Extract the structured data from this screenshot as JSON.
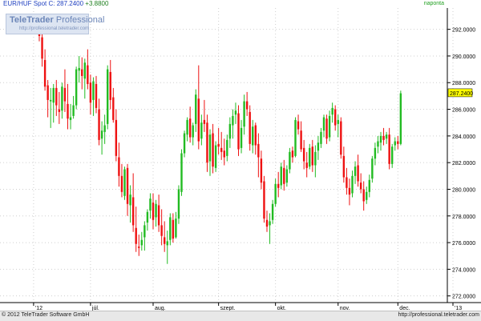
{
  "header": {
    "title": "EUR/HUF Spot  C: 287.2400  +3.8800",
    "instrument": "EUR/HUF Spot",
    "close_label": "C: 287.2400",
    "change_label": "+3.8800",
    "period": "naponta"
  },
  "logo": {
    "name_bold": "TeleTrader",
    "name_light": " Professional",
    "url": "http://professional.teletrader.com"
  },
  "footer": {
    "copyright": "© 2012 TeleTrader Software GmbH",
    "url": "http://professional.teletrader.com"
  },
  "colors": {
    "up": "#22bb22",
    "down": "#ee1111",
    "grid": "#cfcfcf",
    "axis": "#000000",
    "price_tag": "#ffff00"
  },
  "chart_data": {
    "type": "candlestick",
    "title": "EUR/HUF Spot",
    "ylim": [
      271.5,
      293.6
    ],
    "y_ticks": [
      "272.0000",
      "274.0000",
      "276.0000",
      "278.0000",
      "280.0000",
      "282.0000",
      "284.0000",
      "286.0000",
      "288.0000",
      "290.0000",
      "292.0000"
    ],
    "x_ticks": [
      {
        "label": "'12",
        "index": -2
      },
      {
        "label": "júl.",
        "index": 18
      },
      {
        "label": "aug.",
        "index": 40
      },
      {
        "label": "szept.",
        "index": 63
      },
      {
        "label": "okt.",
        "index": 83
      },
      {
        "label": "nov.",
        "index": 105
      },
      {
        "label": "dec.",
        "index": 126
      },
      {
        "label": "'13",
        "index": 147
      }
    ],
    "last_price_label": "287.2400",
    "last_price": 287.24,
    "grid": true,
    "candles": [
      [
        292.9,
        293.1,
        291.1,
        291.5
      ],
      [
        291.4,
        291.8,
        289.2,
        289.8
      ],
      [
        289.7,
        290.5,
        287.4,
        287.7
      ],
      [
        287.8,
        288.2,
        285.4,
        286.7
      ],
      [
        286.6,
        287.6,
        284.6,
        286.7
      ],
      [
        286.5,
        287.9,
        285.0,
        287.6
      ],
      [
        287.6,
        288.2,
        285.5,
        286.3
      ],
      [
        286.0,
        287.3,
        284.9,
        285.8
      ],
      [
        285.9,
        288.0,
        285.3,
        287.7
      ],
      [
        287.6,
        289.0,
        285.8,
        286.6
      ],
      [
        286.4,
        287.9,
        284.5,
        285.3
      ],
      [
        285.2,
        286.4,
        284.5,
        285.4
      ],
      [
        285.5,
        287.0,
        285.3,
        286.3
      ],
      [
        286.3,
        289.2,
        286.0,
        289.0
      ],
      [
        288.9,
        290.0,
        288.0,
        289.1
      ],
      [
        289.0,
        289.9,
        287.5,
        288.5
      ],
      [
        288.3,
        289.8,
        286.8,
        289.5
      ],
      [
        289.3,
        290.5,
        287.5,
        287.9
      ],
      [
        288.0,
        288.6,
        285.6,
        286.5
      ],
      [
        286.7,
        288.4,
        285.5,
        288.1
      ],
      [
        287.9,
        288.5,
        285.7,
        286.1
      ],
      [
        286.0,
        286.8,
        283.3,
        283.7
      ],
      [
        283.8,
        285.1,
        282.6,
        284.4
      ],
      [
        284.3,
        285.6,
        283.4,
        284.8
      ],
      [
        284.9,
        289.3,
        284.5,
        289.0
      ],
      [
        288.8,
        289.7,
        286.0,
        286.7
      ],
      [
        286.9,
        287.6,
        285.0,
        285.2
      ],
      [
        285.2,
        286.0,
        282.1,
        282.5
      ],
      [
        282.4,
        283.5,
        280.2,
        281.0
      ],
      [
        281.0,
        281.9,
        279.4,
        279.8
      ],
      [
        279.5,
        281.7,
        279.2,
        281.5
      ],
      [
        281.6,
        281.9,
        278.0,
        278.9
      ],
      [
        278.8,
        280.3,
        277.5,
        279.6
      ],
      [
        279.4,
        281.2,
        276.8,
        277.3
      ],
      [
        277.1,
        278.7,
        275.3,
        275.9
      ],
      [
        275.7,
        276.6,
        275.0,
        275.6
      ],
      [
        275.8,
        276.8,
        275.4,
        276.2
      ],
      [
        276.4,
        277.6,
        275.4,
        277.3
      ],
      [
        277.5,
        278.5,
        276.9,
        278.3
      ],
      [
        278.4,
        279.7,
        277.8,
        279.3
      ],
      [
        279.0,
        279.7,
        277.0,
        277.7
      ],
      [
        277.9,
        279.2,
        277.2,
        278.9
      ],
      [
        278.8,
        279.6,
        276.8,
        277.3
      ],
      [
        277.3,
        278.5,
        275.8,
        276.5
      ],
      [
        276.4,
        277.6,
        275.3,
        275.9
      ],
      [
        275.8,
        276.9,
        274.4,
        276.1
      ],
      [
        276.2,
        278.2,
        275.8,
        277.9
      ],
      [
        277.7,
        278.2,
        276.0,
        276.3
      ],
      [
        276.4,
        278.3,
        276.3,
        277.8
      ],
      [
        277.8,
        280.3,
        277.4,
        280.0
      ],
      [
        279.8,
        283.0,
        279.5,
        282.7
      ],
      [
        282.7,
        284.4,
        282.4,
        284.2
      ],
      [
        284.1,
        285.4,
        283.6,
        285.2
      ],
      [
        285.3,
        286.2,
        283.5,
        283.9
      ],
      [
        283.9,
        285.0,
        283.3,
        284.8
      ],
      [
        284.9,
        287.5,
        284.3,
        287.1
      ],
      [
        286.8,
        289.3,
        283.0,
        283.6
      ],
      [
        283.8,
        285.6,
        283.3,
        285.0
      ],
      [
        285.2,
        286.7,
        284.3,
        284.9
      ],
      [
        285.0,
        285.6,
        281.3,
        282.0
      ],
      [
        282.1,
        284.5,
        281.0,
        284.1
      ],
      [
        284.2,
        284.9,
        281.2,
        281.7
      ],
      [
        281.6,
        283.6,
        281.3,
        283.3
      ],
      [
        283.4,
        284.6,
        282.6,
        283.2
      ],
      [
        283.1,
        284.3,
        282.2,
        282.8
      ],
      [
        282.9,
        283.8,
        281.8,
        282.4
      ],
      [
        282.5,
        284.1,
        282.1,
        283.7
      ],
      [
        283.8,
        285.4,
        283.1,
        284.9
      ],
      [
        284.8,
        286.0,
        283.8,
        285.5
      ],
      [
        285.6,
        286.5,
        284.9,
        285.9
      ],
      [
        285.7,
        286.3,
        282.5,
        283.0
      ],
      [
        283.1,
        285.2,
        282.7,
        284.6
      ],
      [
        284.7,
        287.1,
        284.1,
        286.6
      ],
      [
        286.6,
        287.3,
        285.5,
        286.0
      ],
      [
        285.8,
        286.3,
        282.9,
        283.4
      ],
      [
        283.3,
        285.2,
        282.7,
        284.7
      ],
      [
        284.8,
        285.0,
        282.6,
        283.3
      ],
      [
        283.4,
        284.2,
        280.9,
        282.4
      ],
      [
        282.3,
        282.9,
        280.0,
        280.5
      ],
      [
        280.6,
        281.0,
        277.5,
        277.8
      ],
      [
        277.7,
        278.4,
        276.8,
        277.2
      ],
      [
        277.3,
        278.2,
        275.9,
        277.6
      ],
      [
        277.7,
        279.2,
        277.4,
        278.9
      ],
      [
        278.9,
        280.8,
        278.7,
        280.4
      ],
      [
        280.4,
        281.3,
        279.4,
        280.1
      ],
      [
        280.3,
        282.0,
        280.0,
        281.7
      ],
      [
        281.6,
        282.2,
        279.9,
        280.4
      ],
      [
        280.5,
        281.8,
        280.2,
        281.5
      ],
      [
        281.5,
        283.1,
        281.2,
        282.8
      ],
      [
        282.9,
        283.2,
        282.0,
        282.4
      ],
      [
        282.5,
        285.4,
        282.4,
        285.2
      ],
      [
        285.1,
        285.6,
        284.1,
        284.5
      ],
      [
        284.4,
        285.1,
        282.8,
        283.0
      ],
      [
        283.1,
        283.7,
        281.5,
        282.1
      ],
      [
        282.0,
        282.8,
        280.9,
        281.6
      ],
      [
        281.7,
        283.4,
        281.5,
        283.1
      ],
      [
        283.2,
        283.7,
        281.3,
        281.8
      ],
      [
        281.8,
        283.3,
        280.9,
        282.8
      ],
      [
        282.9,
        284.0,
        282.2,
        283.5
      ],
      [
        283.4,
        284.6,
        283.1,
        284.3
      ],
      [
        284.4,
        285.6,
        283.9,
        285.4
      ],
      [
        285.3,
        285.6,
        283.4,
        283.8
      ],
      [
        283.9,
        285.9,
        283.6,
        285.5
      ],
      [
        285.6,
        286.5,
        285.0,
        286.1
      ],
      [
        286.0,
        286.3,
        284.4,
        284.8
      ],
      [
        284.9,
        285.6,
        283.9,
        285.2
      ],
      [
        285.1,
        285.4,
        282.3,
        282.6
      ],
      [
        282.5,
        283.2,
        280.5,
        280.9
      ],
      [
        280.9,
        281.6,
        279.6,
        280.1
      ],
      [
        280.1,
        280.8,
        278.8,
        279.6
      ],
      [
        279.7,
        281.4,
        279.4,
        281.0
      ],
      [
        281.0,
        282.1,
        280.4,
        281.7
      ],
      [
        281.8,
        282.6,
        280.2,
        280.6
      ],
      [
        280.5,
        281.2,
        279.7,
        280.0
      ],
      [
        280.0,
        280.6,
        278.4,
        279.1
      ],
      [
        279.2,
        280.2,
        278.9,
        279.8
      ],
      [
        279.8,
        281.1,
        279.4,
        280.7
      ],
      [
        280.8,
        282.5,
        280.5,
        282.3
      ],
      [
        282.3,
        283.5,
        281.8,
        283.1
      ],
      [
        283.2,
        284.0,
        282.7,
        283.6
      ],
      [
        283.5,
        284.3,
        282.9,
        284.0
      ],
      [
        284.0,
        284.6,
        283.3,
        283.7
      ],
      [
        283.8,
        284.3,
        283.4,
        284.1
      ],
      [
        284.1,
        284.6,
        281.5,
        281.9
      ],
      [
        281.9,
        283.4,
        281.6,
        283.2
      ],
      [
        283.3,
        283.9,
        282.9,
        283.6
      ],
      [
        283.6,
        284.0,
        283.0,
        283.4
      ],
      [
        283.4,
        287.4,
        283.3,
        287.2
      ]
    ]
  }
}
